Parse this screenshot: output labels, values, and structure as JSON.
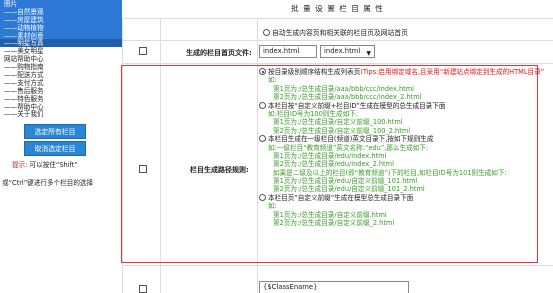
{
  "header": {
    "title": "批 量 设 置 栏 目 属 性"
  },
  "category_list": [
    {
      "label": "图片",
      "state": "sel"
    },
    {
      "label": "——自然景观",
      "state": "sel"
    },
    {
      "label": "——房屋建筑",
      "state": "sel"
    },
    {
      "label": "——动物植物",
      "state": "sel"
    },
    {
      "label": "——素材创意",
      "state": "sel"
    },
    {
      "label": "——明星写真",
      "state": "sel2"
    },
    {
      "label": "——美女明星",
      "state": ""
    },
    {
      "label": "网站帮助中心",
      "state": ""
    },
    {
      "label": "——购物指南",
      "state": ""
    },
    {
      "label": "——配送方式",
      "state": ""
    },
    {
      "label": "——支付方式",
      "state": ""
    },
    {
      "label": "——售后服务",
      "state": ""
    },
    {
      "label": "——特色服务",
      "state": ""
    },
    {
      "label": "——帮助中心",
      "state": ""
    },
    {
      "label": "——关于我们",
      "state": ""
    }
  ],
  "left": {
    "select_all_label": "选定所有栏目",
    "deselect_all_label": "取消选定栏目",
    "tip_prefix": "提示:",
    "tip_line1": "可以按住“Shift”",
    "tip_line2": "或“Ctrl”键进行多个栏目的选择"
  },
  "top_option": {
    "label": "自动生成内容页和相关联的栏目页及网站首页"
  },
  "index_file": {
    "label": "生成的栏目首页文件:",
    "value": "index.html",
    "select_value": "index.html"
  },
  "path_rule": {
    "label": "栏目生成路径规则:",
    "option1": {
      "title_pre": "按目录级别顺序结构生成列表页",
      "title_red": "(Tips:启用绑定域名,且采用“新建站点绑定到生成的HTML目录”",
      "ex_head": "如:",
      "ex1": "第1页为:/总生成目录/aaa/bbb/ccc/index.html",
      "ex2": "第2页为:/总生成目录/aaa/bbb/ccc/index_2.html"
    },
    "option2": {
      "title": "本栏目按“自定义前缀+栏目ID”生成在模型的总生成目录下面",
      "ex_head": "如:栏目ID号为100则生成如下:",
      "ex1": "第1页为:/总生成目录/自定义前缀_100.html",
      "ex2": "第2页为:/总生成目录/自定义前缀_100_2.html"
    },
    "option3": {
      "title": "本栏目生成在一级栏目(频道)英文目录下,按如下规则生成",
      "ex_head": "如:一级栏目“教育频道”英文名称:“edu”,那么生成如下:",
      "ex1": "第1页为:/总生成目录/edu/index.html",
      "ex2": "第2页为:/总生成目录/edu/index_2.html",
      "ex3": "如果是二级及以上的栏目(即“教育频道”)下的栏目,如栏目ID号为101则生成如下:",
      "ex4": "第1页为:/总生成目录/edu/自定义前缀_101.html",
      "ex5": "第2页为:/总生成目录/edu/自定义前缀_101_2.html"
    },
    "option4": {
      "title": "本栏目页“自定义前缀”生成在模型总生成目录下面",
      "ex_head": "如:",
      "ex1": "第1页为:/总生成目录/自定义前缀.html",
      "ex2": "第2页为:/总生成目录/自定义前缀_2.html"
    }
  },
  "next_row": {
    "value": "{$ClassEname}"
  }
}
